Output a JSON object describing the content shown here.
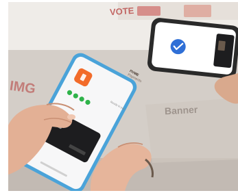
{
  "photo": {
    "background_texts": [
      "VOTE",
      "IMG",
      "Banner"
    ],
    "phone_app": {
      "brand_line1": "ΠΥΜΕ",
      "brand_line2": "Payments",
      "status_text": "Ready to pay"
    }
  },
  "colors": {
    "phone_front_frame": "#4aa3d9",
    "phone_back_frame": "#2a2a2a",
    "accent_orange": "#f26b2a",
    "success_green": "#2fb34a",
    "check_blue": "#2f6fd6",
    "card_black": "#1d1d1f",
    "skin": "#e8b9a0"
  }
}
